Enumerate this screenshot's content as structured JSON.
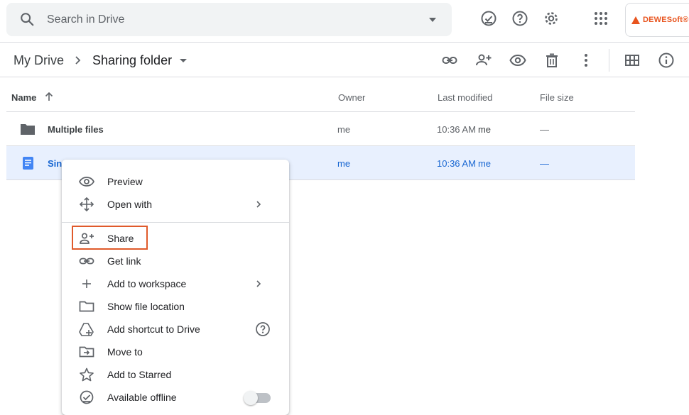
{
  "search": {
    "placeholder": "Search in Drive"
  },
  "header_icons": [
    "offline-ready-icon",
    "help-icon",
    "settings-icon",
    "apps-grid-icon"
  ],
  "account": {
    "brand": "DEWESoft®"
  },
  "breadcrumb": {
    "root": "My Drive",
    "current": "Sharing folder"
  },
  "actions": [
    "link-icon",
    "add-person-icon",
    "preview-eye-icon",
    "trash-icon",
    "more-vert-icon",
    "grid-view-icon",
    "info-icon"
  ],
  "table": {
    "headers": {
      "name": "Name",
      "owner": "Owner",
      "modified": "Last modified",
      "size": "File size"
    },
    "rows": [
      {
        "name": "Multiple files",
        "icon": "folder-icon",
        "owner": "me",
        "modified": "10:36 AM",
        "modified_by": "me",
        "size": "—",
        "selected": false
      },
      {
        "name": "Sin",
        "icon": "doc-icon",
        "owner": "me",
        "modified": "10:36 AM",
        "modified_by": "me",
        "size": "—",
        "selected": true
      }
    ]
  },
  "context_menu": {
    "items": [
      {
        "label": "Preview",
        "icon": "eye-icon"
      },
      {
        "label": "Open with",
        "icon": "move-arrows-icon",
        "submenu": true
      },
      {
        "label": "Share",
        "icon": "add-person-icon",
        "highlighted": true
      },
      {
        "label": "Get link",
        "icon": "link-icon"
      },
      {
        "label": "Add to workspace",
        "icon": "plus-icon",
        "submenu": true
      },
      {
        "label": "Show file location",
        "icon": "folder-outline-icon"
      },
      {
        "label": "Add shortcut to Drive",
        "icon": "drive-shortcut-icon",
        "help": true
      },
      {
        "label": "Move to",
        "icon": "move-to-folder-icon"
      },
      {
        "label": "Add to Starred",
        "icon": "star-icon"
      },
      {
        "label": "Available offline",
        "icon": "offline-check-icon",
        "toggle": false
      }
    ]
  },
  "colors": {
    "accent": "#1967d2",
    "selected_row": "#e8f0fe",
    "highlight_border": "#e05a2b",
    "brand": "#e8541e"
  }
}
